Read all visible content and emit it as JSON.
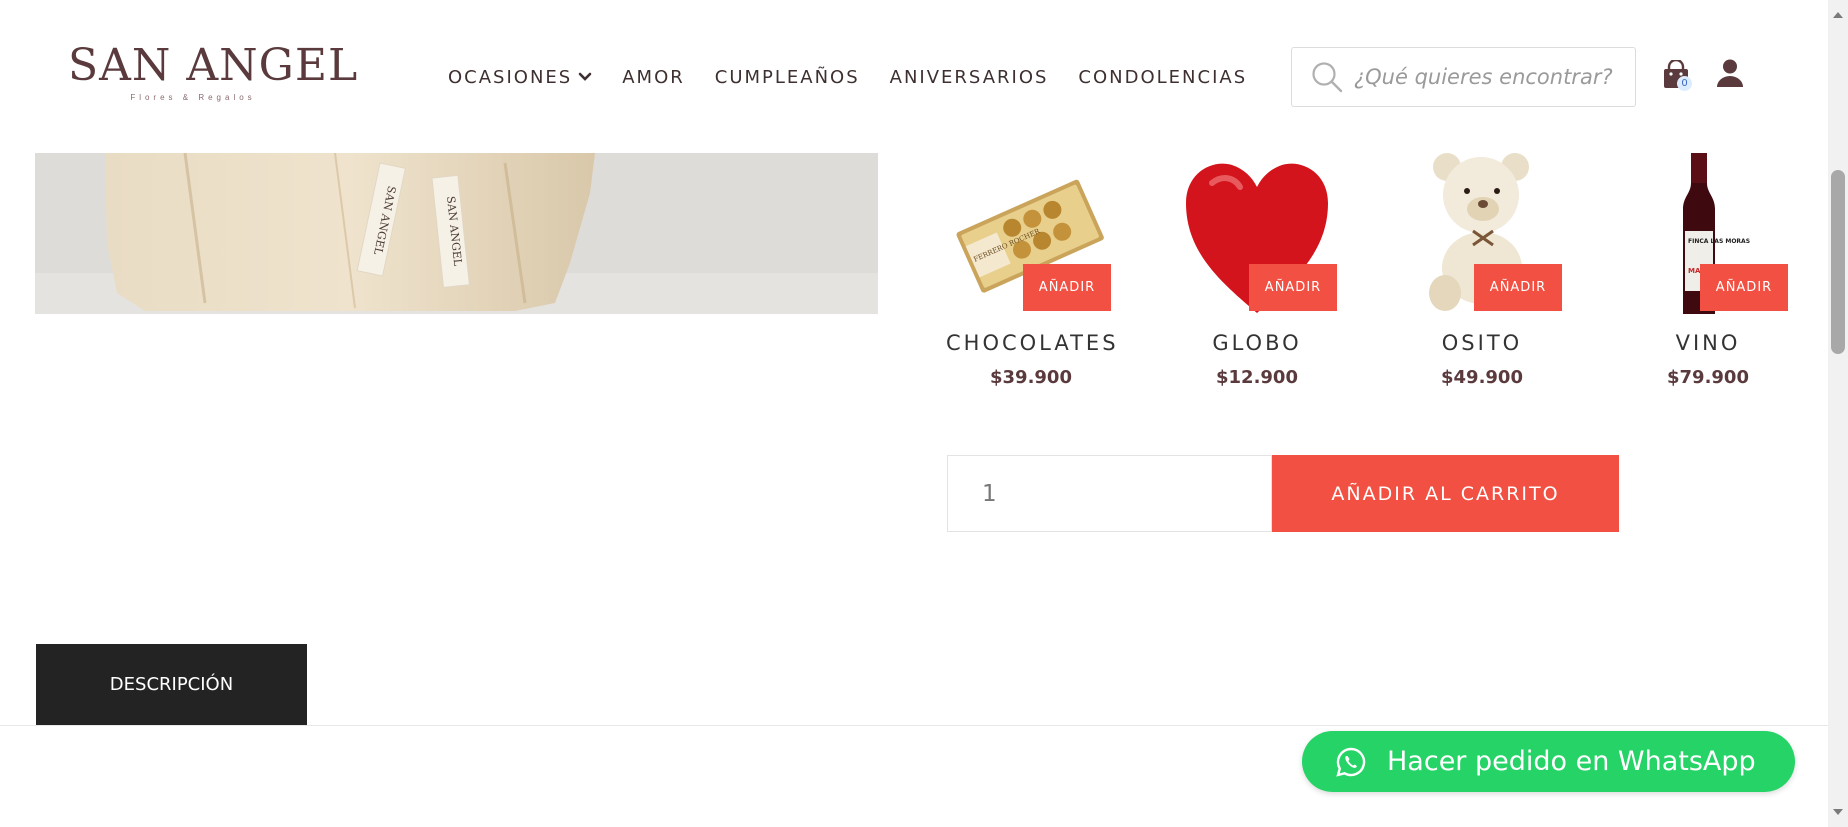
{
  "brand": {
    "name": "SAN ANGEL",
    "tagline": "Flores & Regalos"
  },
  "nav": {
    "items": [
      {
        "label": "OCASIONES",
        "has_dropdown": true
      },
      {
        "label": "AMOR"
      },
      {
        "label": "CUMPLEAÑOS"
      },
      {
        "label": "ANIVERSARIOS"
      },
      {
        "label": "CONDOLENCIAS"
      }
    ]
  },
  "search": {
    "placeholder": "¿Qué quieres encontrar?",
    "icon": "search-icon"
  },
  "cart": {
    "count": "0",
    "icon": "shopping-bag-icon"
  },
  "account": {
    "icon": "user-icon"
  },
  "addons": [
    {
      "name": "CHOCOLATES",
      "price": "$39.900",
      "button": "AÑADIR"
    },
    {
      "name": "GLOBO",
      "price": "$12.900",
      "button": "AÑADIR"
    },
    {
      "name": "OSITO",
      "price": "$49.900",
      "button": "AÑADIR"
    },
    {
      "name": "VINO",
      "price": "$79.900",
      "button": "AÑADIR"
    }
  ],
  "purchase": {
    "quantity": "1",
    "add_to_cart_label": "AÑADIR AL CARRITO"
  },
  "tabs": {
    "description": "DESCRIPCIÓN"
  },
  "whatsapp": {
    "label": "Hacer pedido en WhatsApp"
  },
  "product_image_text": {
    "wrap_text": "SAN ANGEL"
  },
  "addon_image_text": {
    "chocolate_box": "FERRERO ROCHER",
    "wine_label": "FINCA LAS MORAS",
    "wine_variety": "MAL"
  },
  "colors": {
    "accent": "#f25042",
    "whatsapp": "#25d366",
    "dark": "#232323",
    "brand": "#5a3a3c"
  }
}
